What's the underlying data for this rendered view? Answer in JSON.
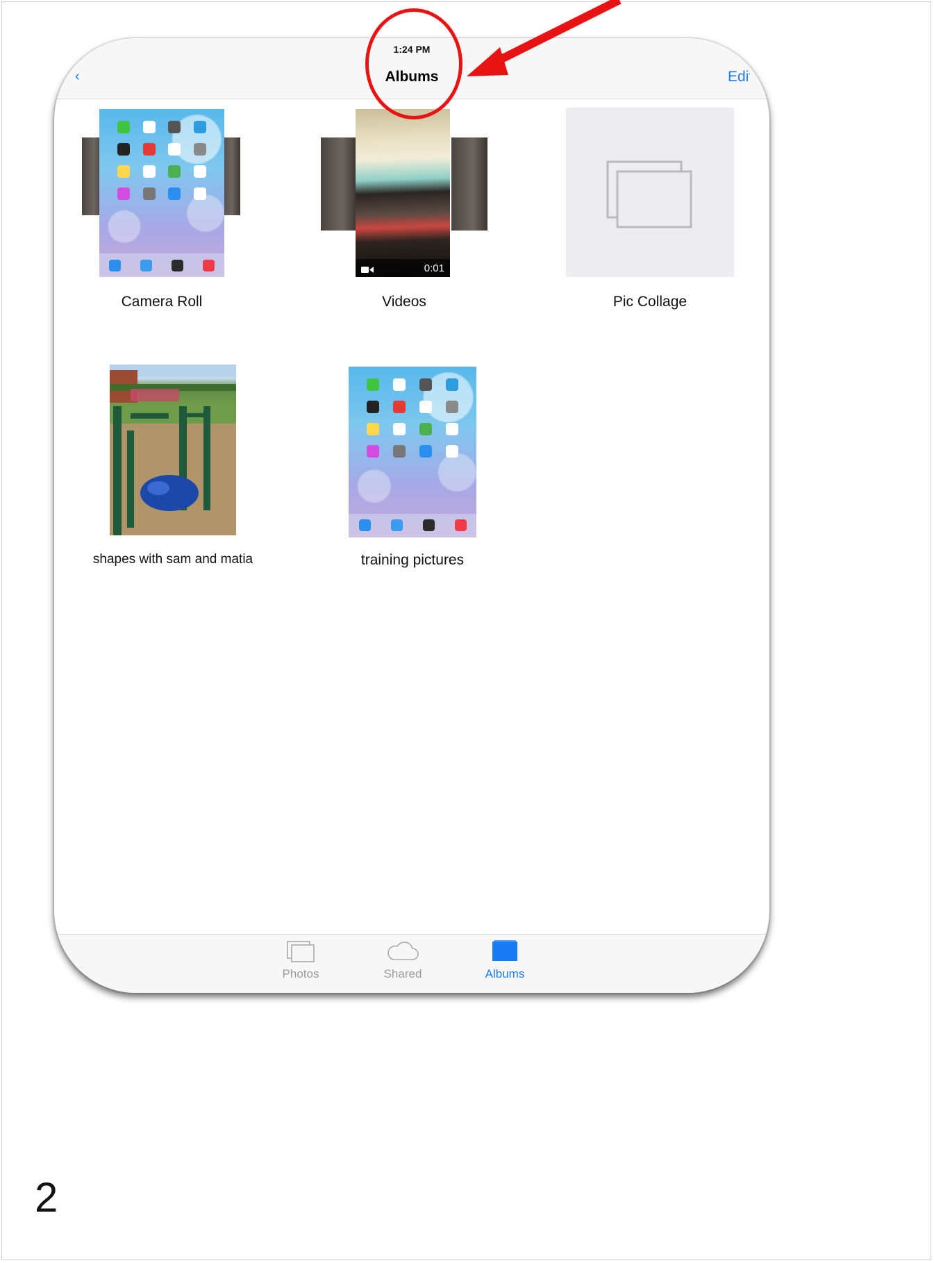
{
  "status_bar": {
    "time": "1:24 PM"
  },
  "nav": {
    "title": "Albums",
    "back_fragment": "‹",
    "edit_fragment": "Edit"
  },
  "albums": [
    {
      "label": "Camera Roll"
    },
    {
      "label": "Videos",
      "video_duration": "0:01"
    },
    {
      "label": "Pic Collage"
    },
    {
      "label": "shapes with sam and matia"
    },
    {
      "label": "training pictures"
    }
  ],
  "tabs": [
    {
      "label": "Photos",
      "icon": "photos-icon",
      "selected": false
    },
    {
      "label": "Shared",
      "icon": "cloud-icon",
      "selected": false
    },
    {
      "label": "Albums",
      "icon": "albums-folder-icon",
      "selected": true
    }
  ],
  "page_number": "2",
  "colors": {
    "accent": "#1a7cf5",
    "annotation": "#e81414"
  },
  "app_icon_colors": [
    "#3fc53f",
    "#ffffff",
    "#555555",
    "#2e9de0",
    "#222222",
    "#e53935",
    "#ffffff",
    "#8a8a8a",
    "#ffd84d",
    "#ffffff",
    "#4caf50",
    "#ffffff",
    "#d34ce0",
    "#777777",
    "#2b8ff0",
    "#ffffff"
  ],
  "dock_icon_colors": [
    "#2b8ff0",
    "#3a9bef",
    "#2b2b2b",
    "#f03a4a"
  ]
}
